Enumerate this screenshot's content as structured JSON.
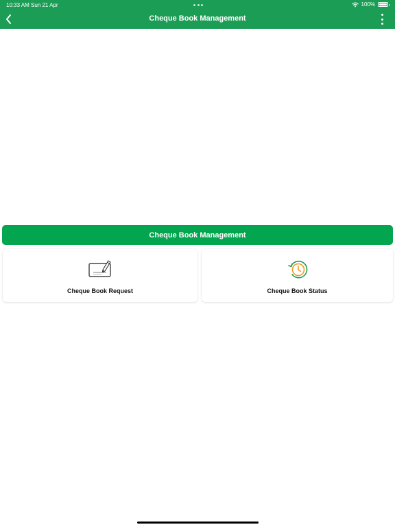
{
  "status_bar": {
    "time": "10:33 AM",
    "date": "Sun 21 Apr",
    "battery": "100%"
  },
  "header": {
    "title": "Cheque Book Management",
    "back_icon": "chevron-left-icon",
    "more_icon": "vertical-ellipsis-icon"
  },
  "section": {
    "title": "Cheque Book Management"
  },
  "cards": [
    {
      "label": "Cheque Book Request",
      "icon": "cheque-pen-icon"
    },
    {
      "label": "Cheque Book Status",
      "icon": "clock-history-icon"
    }
  ],
  "colors": {
    "header_bg": "#1b9d55",
    "banner_bg": "#03a54e",
    "status_icon_green": "#1f9b52",
    "status_icon_orange": "#f39a1e"
  }
}
